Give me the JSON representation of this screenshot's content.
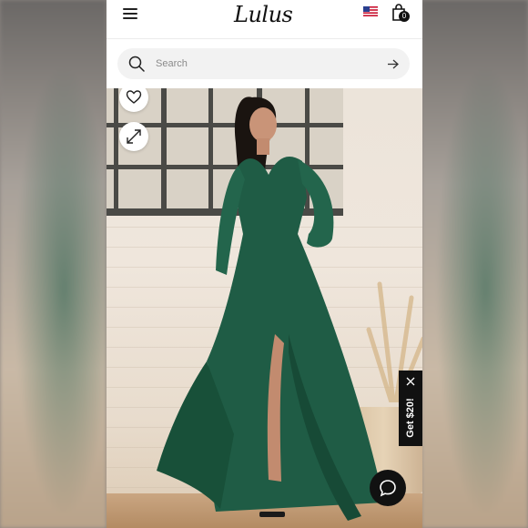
{
  "header": {
    "logo_text": "Lulus",
    "menu_icon": "hamburger-menu-icon",
    "flag_icon": "us-flag-icon",
    "bag_icon": "shopping-bag-icon",
    "bag_count": "0"
  },
  "search": {
    "placeholder": "Search",
    "icon": "search-icon",
    "submit_icon": "arrow-right-icon"
  },
  "product_image": {
    "wishlist_icon": "heart-icon",
    "expand_icon": "expand-arrows-icon",
    "dress_color": "#1f5c45"
  },
  "promo": {
    "label": "Get $20!",
    "close_icon": "close-icon"
  },
  "chat": {
    "icon": "chat-bubble-icon"
  },
  "colors": {
    "accent": "#111111",
    "search_bg": "#f2f2f2"
  }
}
